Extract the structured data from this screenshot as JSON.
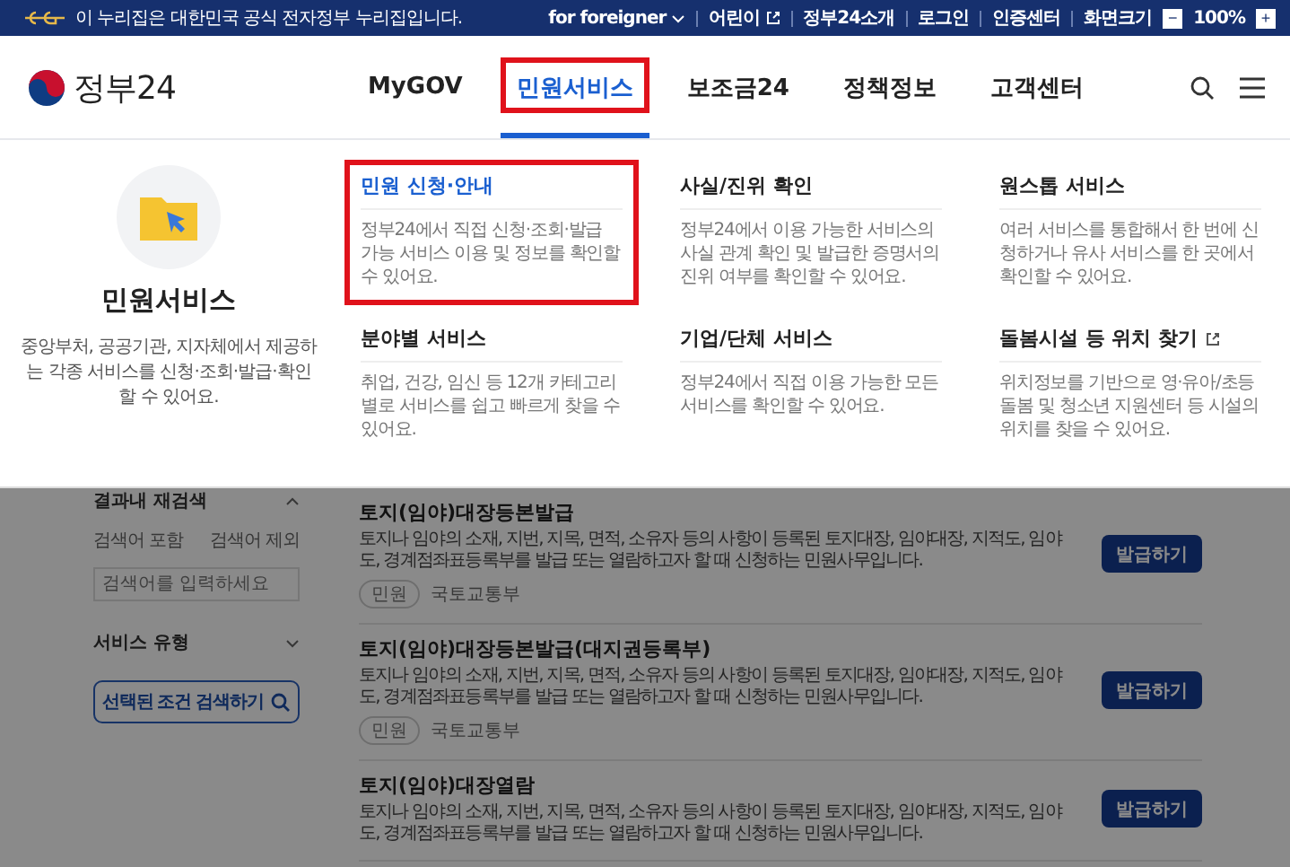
{
  "top_bar": {
    "notice": "이 누리집은 대한민국 공식 전자정부 누리집입니다.",
    "links": [
      {
        "label": "for foreigner",
        "kind": "dropdown"
      },
      {
        "label": "어린이",
        "kind": "external"
      },
      {
        "label": "정부24소개",
        "kind": "plain"
      },
      {
        "label": "로그인",
        "kind": "plain"
      },
      {
        "label": "인증센터",
        "kind": "plain"
      }
    ],
    "zoom": {
      "label": "화면크기",
      "minus": "−",
      "value": "100%",
      "plus": "+"
    }
  },
  "header": {
    "logo": "정부24",
    "nav": [
      {
        "label": "MyGOV",
        "selected": false,
        "highlighted": false
      },
      {
        "label": "민원서비스",
        "selected": true,
        "highlighted": true
      },
      {
        "label": "보조금24",
        "selected": false,
        "highlighted": false
      },
      {
        "label": "정책정보",
        "selected": false,
        "highlighted": false
      },
      {
        "label": "고객센터",
        "selected": false,
        "highlighted": false
      }
    ]
  },
  "mega_menu": {
    "title": "민원서비스",
    "description": "중앙부처, 공공기관, 지자체에서 제공하는 각종 서비스를 신청·조회·발급·확인할 수 있어요.",
    "items": [
      {
        "title": "민원 신청·안내",
        "description": "정부24에서 직접 신청·조회·발급 가능 서비스 이용 및 정보를 확인할 수 있어요.",
        "selected": true,
        "highlighted": true,
        "external": false
      },
      {
        "title": "사실/진위 확인",
        "description": "정부24에서 이용 가능한 서비스의 사실 관계 확인 및 발급한 증명서의 진위 여부를 확인할 수 있어요.",
        "selected": false,
        "highlighted": false,
        "external": false
      },
      {
        "title": "원스톱 서비스",
        "description": "여러 서비스를 통합해서 한 번에 신청하거나 유사 서비스를 한 곳에서 확인할 수 있어요.",
        "selected": false,
        "highlighted": false,
        "external": false
      },
      {
        "title": "분야별 서비스",
        "description": "취업, 건강, 임신 등 12개 카테고리별로 서비스를 쉽고 빠르게 찾을 수 있어요.",
        "selected": false,
        "highlighted": false,
        "external": false
      },
      {
        "title": "기업/단체 서비스",
        "description": "정부24에서 직접 이용 가능한 모든 서비스를 확인할 수 있어요.",
        "selected": false,
        "highlighted": false,
        "external": false
      },
      {
        "title": "돌봄시설 등 위치 찾기",
        "description": "위치정보를 기반으로 영·유아/초등 돌봄 및 청소년 지원센터 등 시설의 위치를 찾을 수 있어요.",
        "selected": false,
        "highlighted": false,
        "external": true
      }
    ]
  },
  "sidebar": {
    "section": "결과내 재검색",
    "options": [
      "검색어 포함",
      "검색어 제외"
    ],
    "search": {
      "placeholder": "검색어를 입력하세요"
    },
    "filter": "서비스 유형",
    "button": "선택된 조건 검색하기"
  },
  "results": [
    {
      "title": "토지(임야)대장등본발급",
      "description": "토지나 임야의 소재, 지번, 지목, 면적, 소유자 등의 사항이 등록된 토지대장, 임야대장, 지적도, 임야도, 경계점좌표등록부를 발급 또는 열람하고자 할 때 신청하는 민원사무입니다.",
      "tag": "민원",
      "agency": "국토교통부",
      "button": "발급하기"
    },
    {
      "title": "토지(임야)대장등본발급(대지권등록부)",
      "description": "토지나 임야의 소재, 지번, 지목, 면적, 소유자 등의 사항이 등록된 토지대장, 임야대장, 지적도, 임야도, 경계점좌표등록부를 발급 또는 열람하고자 할 때 신청하는 민원사무입니다.",
      "tag": "민원",
      "agency": "국토교통부",
      "button": "발급하기"
    },
    {
      "title": "토지(임야)대장열람",
      "description": "토지나 임야의 소재, 지번, 지목, 면적, 소유자 등의 사항이 등록된 토지대장, 임야대장, 지적도, 임야도, 경계점좌표등록부를 발급 또는 열람하고자 할 때 신청하는 민원사무입니다.",
      "button": "발급하기"
    }
  ]
}
